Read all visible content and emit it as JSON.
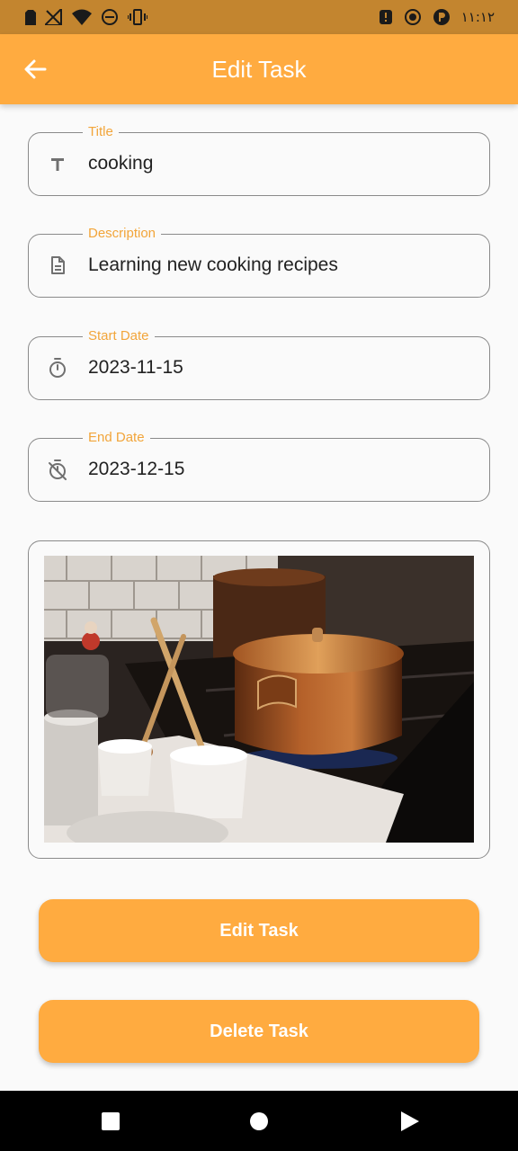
{
  "status_bar": {
    "left_icons": [
      "sim-icon",
      "no-signal-icon",
      "wifi-icon",
      "do-not-disturb-icon",
      "vibrate-icon"
    ],
    "right_icons": [
      "alert-icon",
      "capture-icon",
      "app-icon"
    ],
    "time": "١١:١٢"
  },
  "app_bar": {
    "title": "Edit Task",
    "back_icon": "arrow-back-icon"
  },
  "form": {
    "title": {
      "label": "Title",
      "value": "cooking",
      "icon": "text-icon"
    },
    "description": {
      "label": "Description",
      "value": "Learning new cooking recipes",
      "icon": "document-icon"
    },
    "start_date": {
      "label": "Start Date",
      "value": "2023-11-15",
      "icon": "timer-icon"
    },
    "end_date": {
      "label": "End Date",
      "value": "2023-12-15",
      "icon": "timer-off-icon"
    }
  },
  "image": {
    "subject": "copper-pot-on-stove-photo"
  },
  "buttons": {
    "edit_label": "Edit Task",
    "delete_label": "Delete Task"
  },
  "nav_bar": {
    "icons": [
      "recents-square-icon",
      "home-circle-icon",
      "back-triangle-icon"
    ]
  },
  "colors": {
    "accent": "#ffab40",
    "label": "#f2a53a",
    "status_bar": "#c3852f",
    "border": "#8a8a8a"
  }
}
